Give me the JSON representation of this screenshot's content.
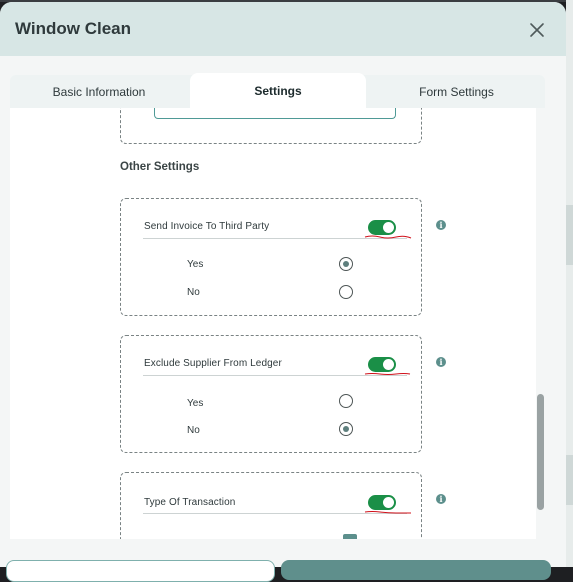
{
  "modal": {
    "title": "Window Clean",
    "close_icon": "close-icon"
  },
  "tabs": [
    {
      "label": "Basic Information",
      "active": false
    },
    {
      "label": "Settings",
      "active": true
    },
    {
      "label": "Form Settings",
      "active": false
    }
  ],
  "section": {
    "title": "Other Settings"
  },
  "settings": [
    {
      "label": "Send Invoice To  Third Party",
      "enabled": true,
      "options": [
        {
          "label": "Yes",
          "selected": true
        },
        {
          "label": "No",
          "selected": false
        }
      ]
    },
    {
      "label": "Exclude Supplier  From Ledger",
      "enabled": true,
      "options": [
        {
          "label": "Yes",
          "selected": false
        },
        {
          "label": "No",
          "selected": true
        }
      ]
    },
    {
      "label": "Type Of Transaction",
      "enabled": true,
      "options": []
    }
  ],
  "colors": {
    "accent": "#5c8f8c",
    "toggle_on": "#1a8f47",
    "header_bg": "#d7e6e5",
    "squiggle": "#d0101a"
  },
  "icons": {
    "info": "info-icon"
  }
}
